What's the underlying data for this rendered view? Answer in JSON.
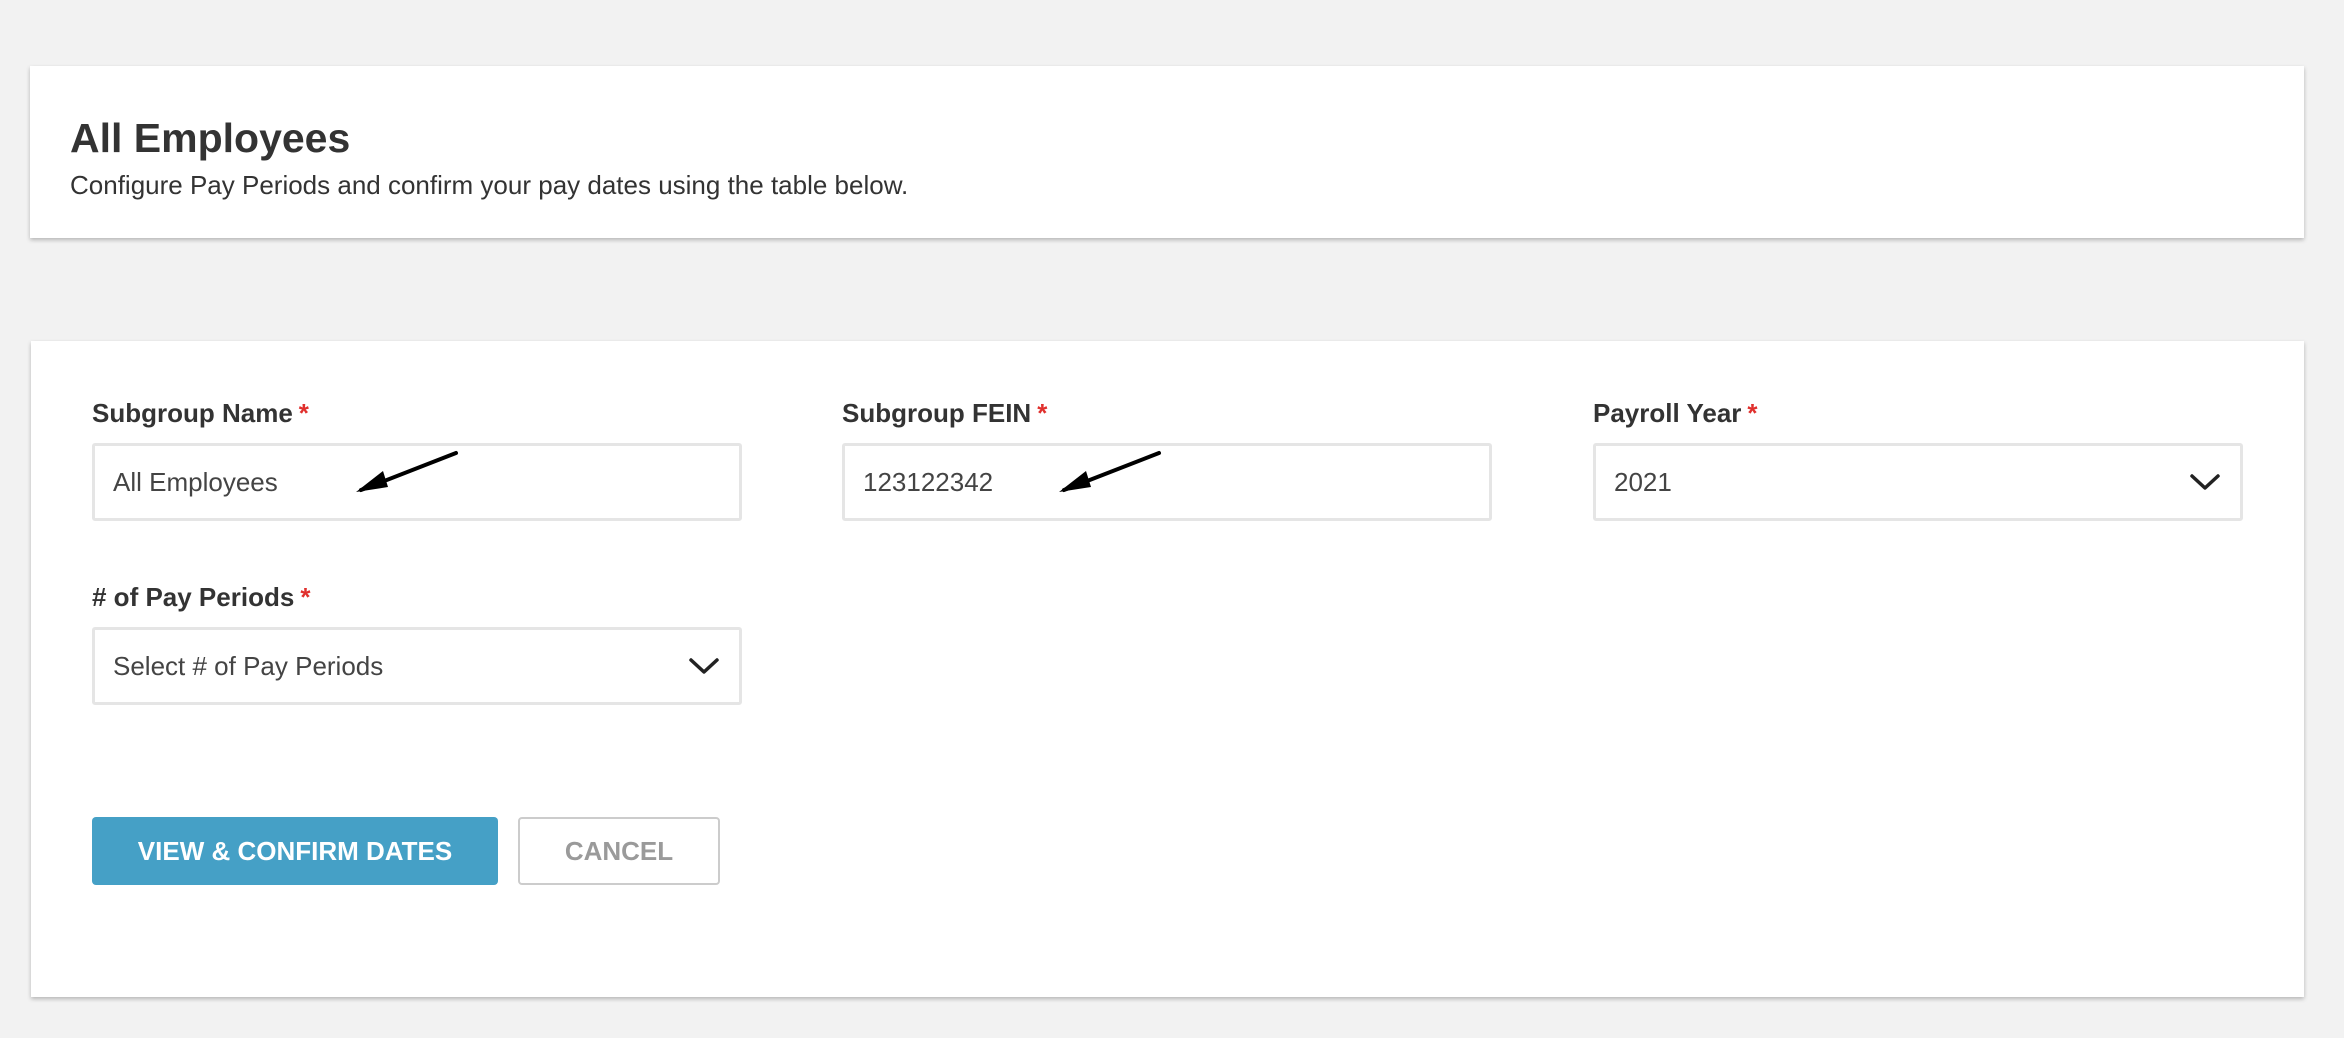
{
  "header": {
    "title": "All Employees",
    "subtitle": "Configure Pay Periods and confirm your pay dates using the table below."
  },
  "form": {
    "subgroup_name": {
      "label": "Subgroup Name",
      "required_mark": "*",
      "value": "All Employees"
    },
    "subgroup_fein": {
      "label": "Subgroup FEIN",
      "required_mark": "*",
      "value": "123122342"
    },
    "payroll_year": {
      "label": "Payroll Year",
      "required_mark": "*",
      "selected": "2021"
    },
    "pay_periods": {
      "label": "# of Pay Periods",
      "required_mark": "*",
      "placeholder": "Select # of Pay Periods"
    }
  },
  "actions": {
    "confirm_label": "VIEW & CONFIRM DATES",
    "cancel_label": "CANCEL"
  },
  "icons": {
    "dropdown": "chevron-down-icon",
    "annotation": "arrow-annotation-icon"
  },
  "colors": {
    "background": "#f2f2f2",
    "card": "#ffffff",
    "primary_button": "#45a0c6",
    "required": "#e0302d",
    "text": "#333333"
  }
}
